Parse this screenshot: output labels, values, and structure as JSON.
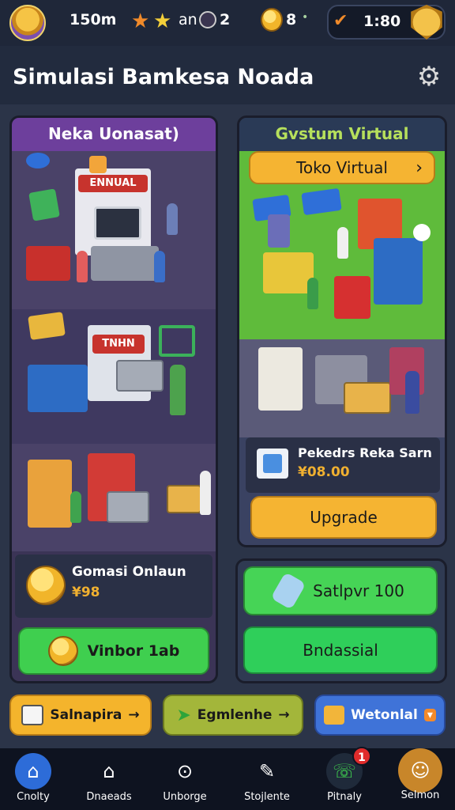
{
  "status_bar": {
    "distance": "150m",
    "stars_label": "an",
    "stars_count": "2",
    "coins": "8",
    "dot": "•",
    "timer": "1:80"
  },
  "header": {
    "title": "Simulasi Bamkesa Noada",
    "settings_icon": "gear-icon"
  },
  "left_panel": {
    "title": "Neka Uonasat)",
    "scene1_sign": "ENNUAL",
    "scene2_sign": "TNHN",
    "info_title": "Gomasi Onlaun",
    "info_value": "¥98",
    "button_label": "Vinbor 1ab"
  },
  "right_panel": {
    "title": "Gvstum Virtual",
    "shop_button": "Toko Virtual",
    "shop_arrow": "›",
    "item_title": "Pekedrs Reka Sarn",
    "item_price": "¥08.00",
    "upgrade_label": "Upgrade"
  },
  "right_buttons": {
    "first_label": "Satlpvr 100",
    "second_label": "Bndassial"
  },
  "action_row": [
    {
      "label": "Salnapira",
      "arrow": "→",
      "color": "#f4b42c"
    },
    {
      "label": "Egmlenhe",
      "arrow": "→",
      "color": "#a3b63a"
    },
    {
      "label": "Wetonlal",
      "arrow": "▾",
      "color": "#3f73d8"
    }
  ],
  "bottom_nav": [
    {
      "label": "Cnolty",
      "icon": "home-icon",
      "active": true
    },
    {
      "label": "Dnaeads",
      "icon": "house-outline-icon"
    },
    {
      "label": "Unborge",
      "icon": "compass-icon"
    },
    {
      "label": "Stojlente",
      "icon": "edit-icon"
    },
    {
      "label": "Pitnaly",
      "icon": "chat-icon",
      "badge": "1"
    },
    {
      "label": "Selmon",
      "icon": "profile-icon"
    }
  ]
}
